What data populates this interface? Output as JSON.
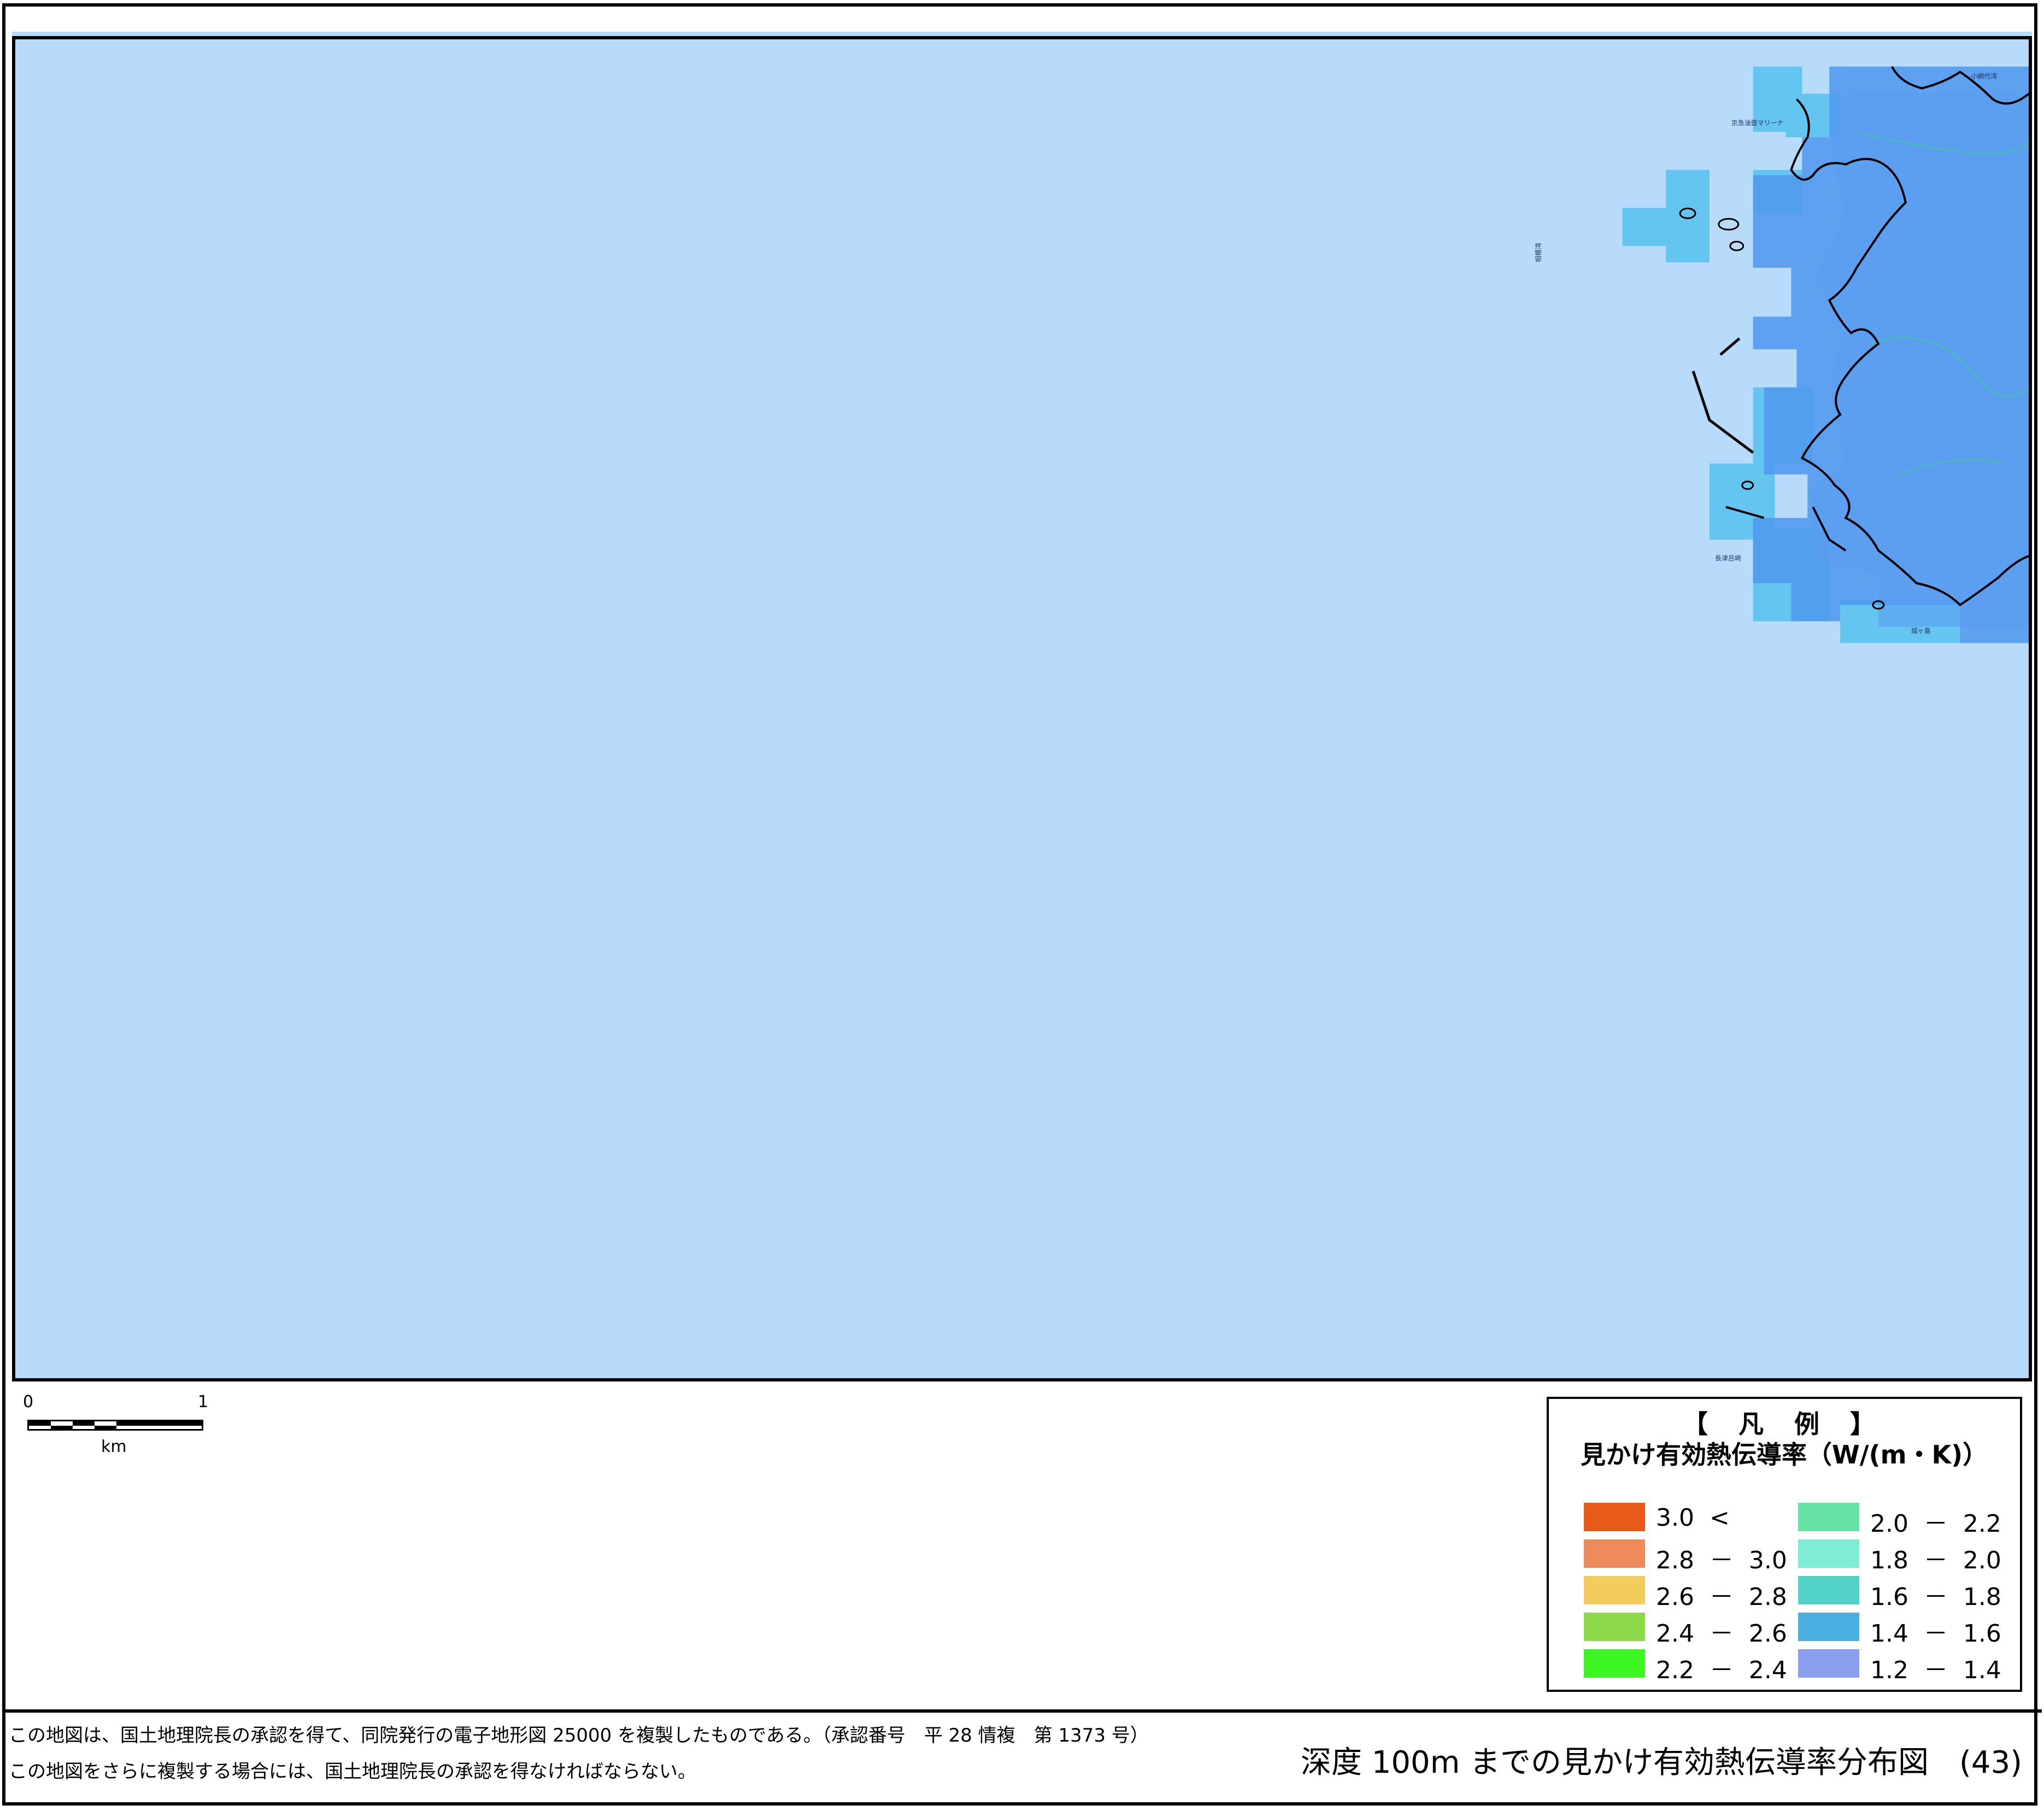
{
  "map": {
    "sea_color": "#b8dbfc",
    "coast_labels": [
      "小網代湾",
      "京急油壺マリーナ",
      "相模湾",
      "長津呂崎",
      "城ヶ島"
    ]
  },
  "scalebar": {
    "start_label": "0",
    "end_label": "1",
    "unit_label": "km"
  },
  "legend": {
    "title": "【 凡 例 】",
    "subtitle": "見かけ有効熱伝導率（W/(m・K)）",
    "items": [
      {
        "label": "3.0  <",
        "color": "#e85a1a"
      },
      {
        "label": "2.8  －  3.0",
        "color": "#ef8a5c"
      },
      {
        "label": "2.6  －  2.8",
        "color": "#f2cc5c"
      },
      {
        "label": "2.4  －  2.6",
        "color": "#8cd94a"
      },
      {
        "label": "2.2  －  2.4",
        "color": "#3ef524"
      },
      {
        "label": "2.0  －  2.2",
        "color": "#66e3a4"
      },
      {
        "label": "1.8  －  2.0",
        "color": "#7fecd6"
      },
      {
        "label": "1.6  －  1.8",
        "color": "#52d2c6"
      },
      {
        "label": "1.4  －  1.6",
        "color": "#4aaee0"
      },
      {
        "label": "1.2  －  1.4",
        "color": "#8aa0ee"
      }
    ]
  },
  "footer": {
    "note_line1": "この地図は、国土地理院長の承認を得て、同院発行の電子地形図 25000 を複製したものである。（承認番号　平 28 情複　第 1373 号）",
    "note_line2": "この地図をさらに複製する場合には、国土地理院長の承認を得なければならない。",
    "title": "深度 100m までの見かけ有効熱伝導率分布図　(43)"
  }
}
